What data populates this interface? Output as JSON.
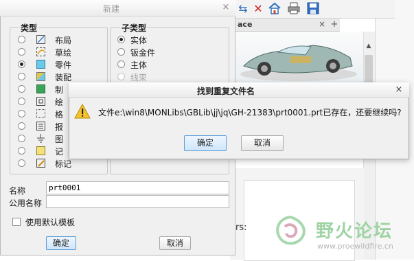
{
  "background_app": {
    "toolbar_icons": [
      "refresh-arrows-icon",
      "delete-x-icon",
      "home-icon",
      "printer-icon",
      "save-floppy-icon"
    ],
    "browser_tab": "ace",
    "tab_close": "×",
    "tab_add": "+",
    "partial_text": "rs:",
    "watermark": {
      "text": "野火论坛",
      "url": "www.proewildfire.cn"
    }
  },
  "new_dialog": {
    "title": "新建",
    "close": "×",
    "type_group": {
      "label": "类型",
      "items": [
        {
          "label": "布局",
          "icon": "layout-icon",
          "selected": false
        },
        {
          "label": "草绘",
          "icon": "sketch-icon",
          "selected": false
        },
        {
          "label": "零件",
          "icon": "part-icon",
          "selected": true
        },
        {
          "label": "装配",
          "icon": "assembly-icon",
          "selected": false
        },
        {
          "label": "制",
          "icon": "manufacturing-icon",
          "selected": false
        },
        {
          "label": "绘",
          "icon": "drawing-icon",
          "selected": false
        },
        {
          "label": "格",
          "icon": "format-icon",
          "selected": false
        },
        {
          "label": "报",
          "icon": "report-icon",
          "selected": false
        },
        {
          "label": "图",
          "icon": "diagram-icon",
          "selected": false
        },
        {
          "label": "记",
          "icon": "notebook-icon",
          "selected": false
        },
        {
          "label": "标记",
          "icon": "markup-icon",
          "selected": false
        }
      ]
    },
    "subtype_group": {
      "label": "子类型",
      "items": [
        {
          "label": "实体",
          "selected": true,
          "disabled": false
        },
        {
          "label": "钣金件",
          "selected": false,
          "disabled": false
        },
        {
          "label": "主体",
          "selected": false,
          "disabled": false
        },
        {
          "label": "线束",
          "selected": false,
          "disabled": true
        }
      ]
    },
    "name_label": "名称",
    "name_value": "prt0001",
    "common_name_label": "公用名称",
    "common_name_value": "",
    "template_checkbox_label": "使用默认模板",
    "template_checked": false,
    "ok": "确定",
    "cancel": "取消"
  },
  "dup_dialog": {
    "title": "找到重复文件名",
    "close": "×",
    "message": "文件e:\\win8\\MONLibs\\GBLib\\jj\\jq\\GH-21383\\prt0001.prt已存在，还要继续吗?",
    "ok": "确定",
    "cancel": "取消"
  }
}
